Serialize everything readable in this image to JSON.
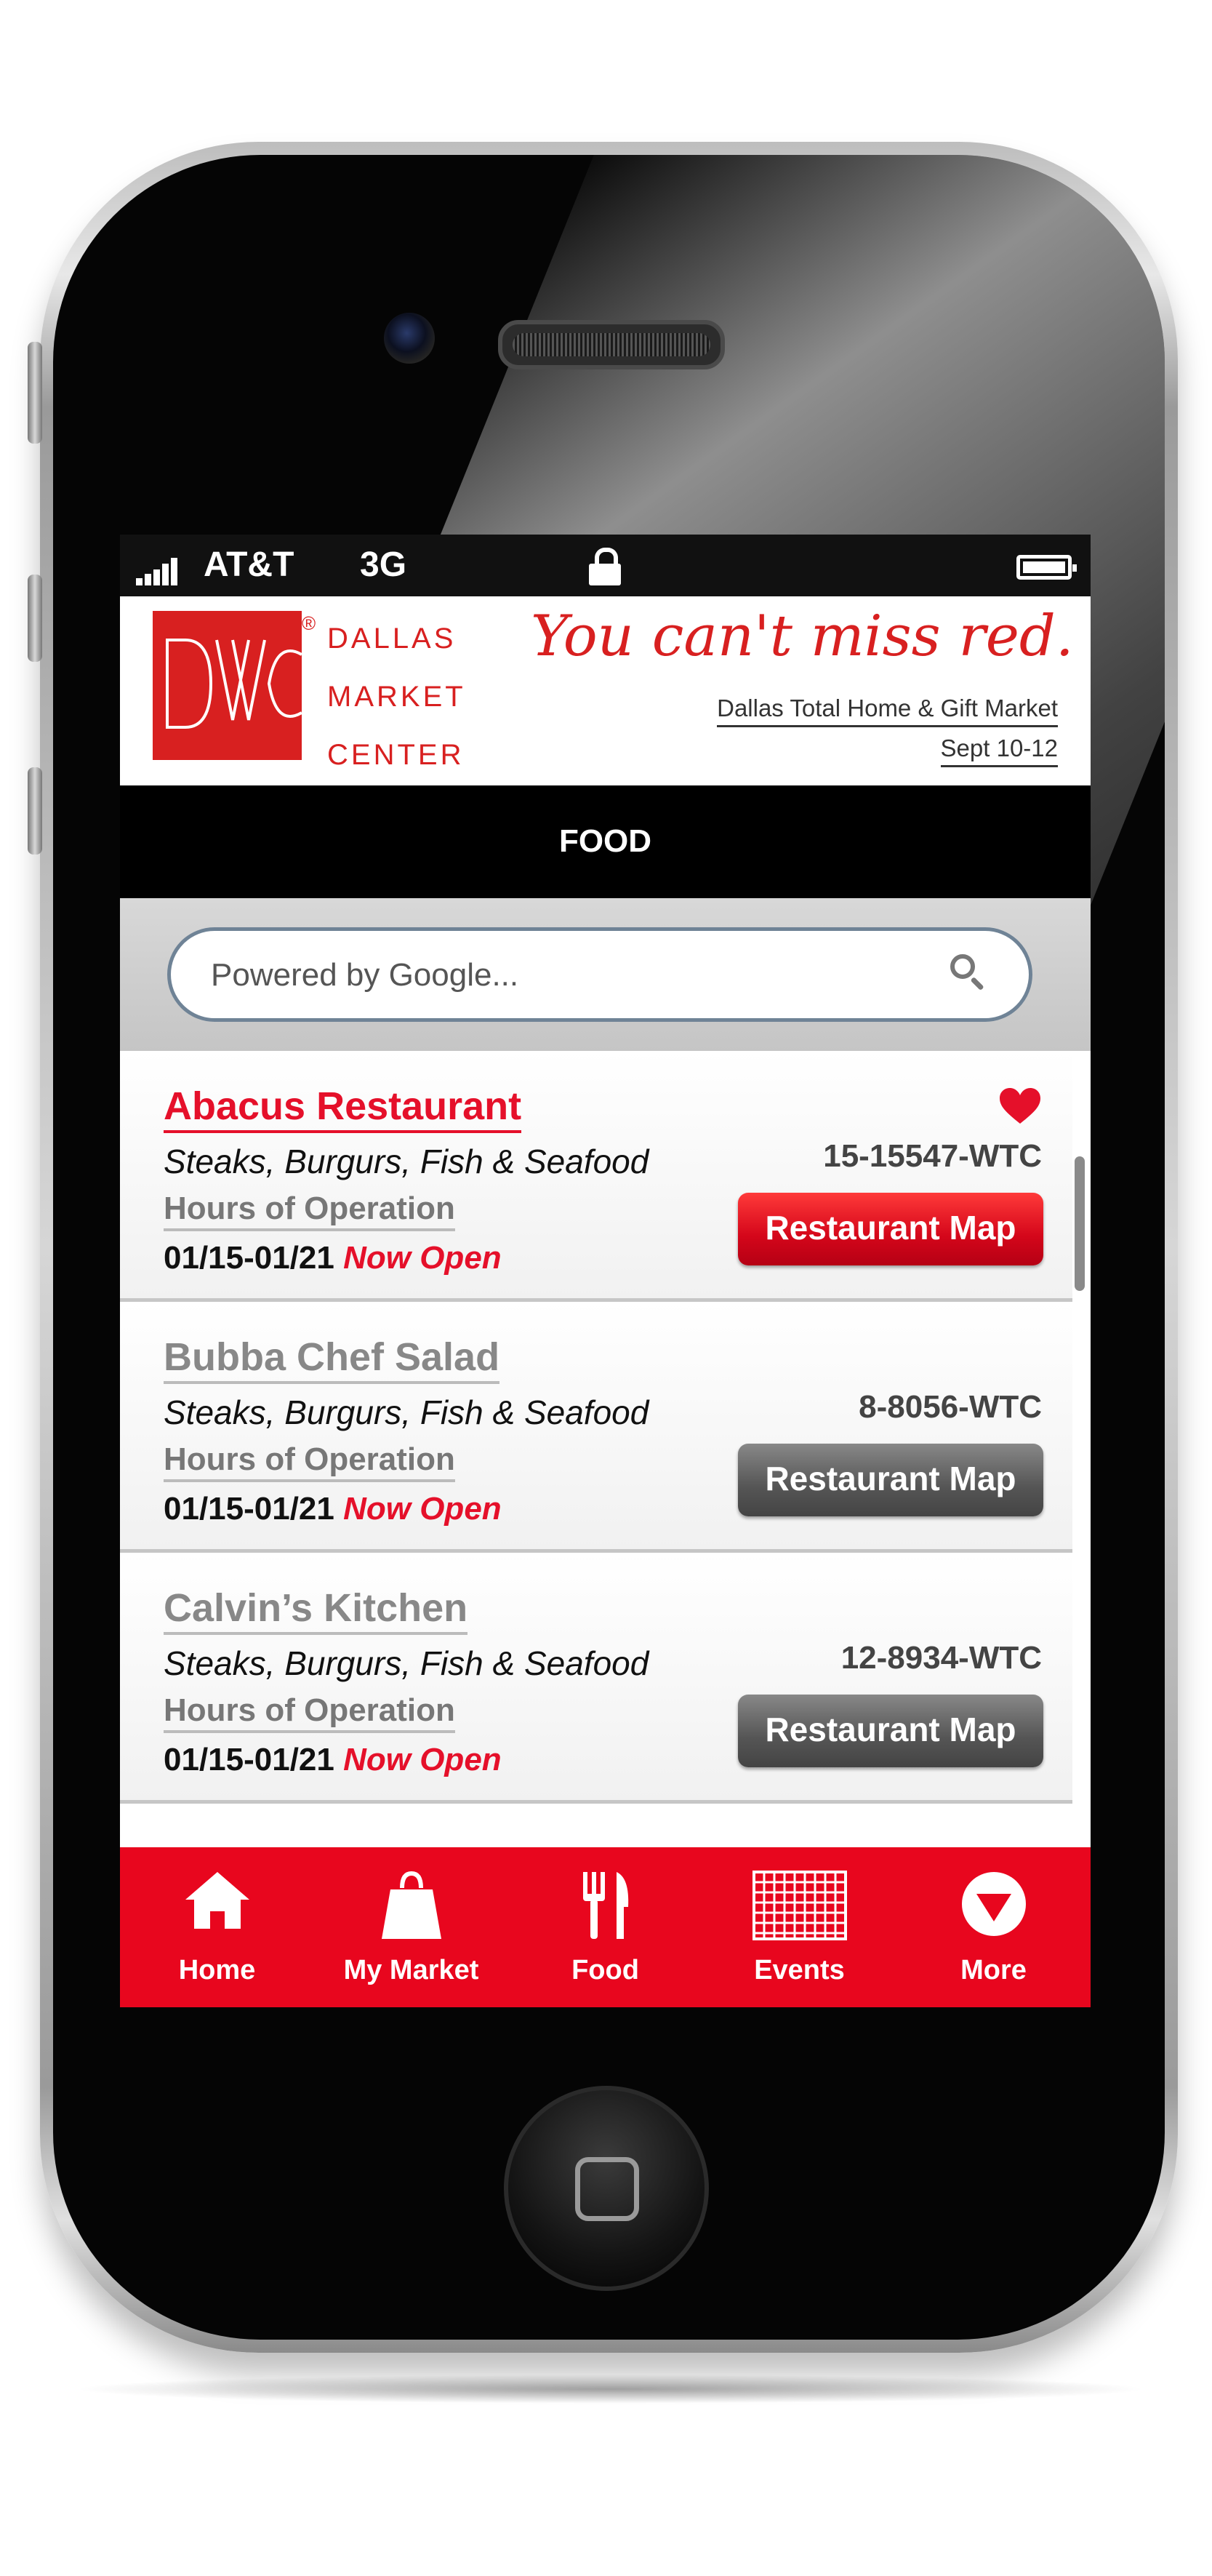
{
  "status_bar": {
    "carrier": "AT&T",
    "network": "3G",
    "lock_icon": "lock-icon",
    "battery_icon": "battery-icon"
  },
  "banner": {
    "logo_lines": [
      "DALLAS",
      "MARKET",
      "CENTER"
    ],
    "logo_reg": "®",
    "tagline": "You can't miss red.",
    "event_name": "Dallas Total Home & Gift Market",
    "event_dates": "Sept 10-12"
  },
  "header": {
    "title": "FOOD"
  },
  "search": {
    "placeholder": "Powered by Google..."
  },
  "restaurants": [
    {
      "name": "Abacus Restaurant",
      "category": "Steaks, Burgurs, Fish & Seafood",
      "hours_label": "Hours of Operation",
      "dates": "01/15-01/21",
      "status": "Now Open",
      "location": "15-15547-WTC",
      "map_label": "Restaurant Map",
      "favorite": true
    },
    {
      "name": "Bubba Chef Salad",
      "category": "Steaks, Burgurs, Fish & Seafood",
      "hours_label": "Hours of Operation",
      "dates": "01/15-01/21",
      "status": "Now Open",
      "location": "8-8056-WTC",
      "map_label": "Restaurant Map",
      "favorite": false
    },
    {
      "name": "Calvin’s Kitchen",
      "category": "Steaks, Burgurs, Fish & Seafood",
      "hours_label": "Hours of Operation",
      "dates": "01/15-01/21",
      "status": "Now Open",
      "location": "12-8934-WTC",
      "map_label": "Restaurant Map",
      "favorite": false
    }
  ],
  "tab_bar": {
    "items": [
      {
        "label": "Home",
        "icon": "home-icon"
      },
      {
        "label": "My Market",
        "icon": "shopping-bag-icon"
      },
      {
        "label": "Food",
        "icon": "fork-knife-icon"
      },
      {
        "label": "Events",
        "icon": "calendar-grid-icon"
      },
      {
        "label": "More",
        "icon": "down-arrow-circle-icon"
      }
    ]
  },
  "colors": {
    "brand_red": "#e5102a",
    "logo_red": "#d82020",
    "tab_bar_red": "#e8061e",
    "title_bar": "#000000"
  }
}
